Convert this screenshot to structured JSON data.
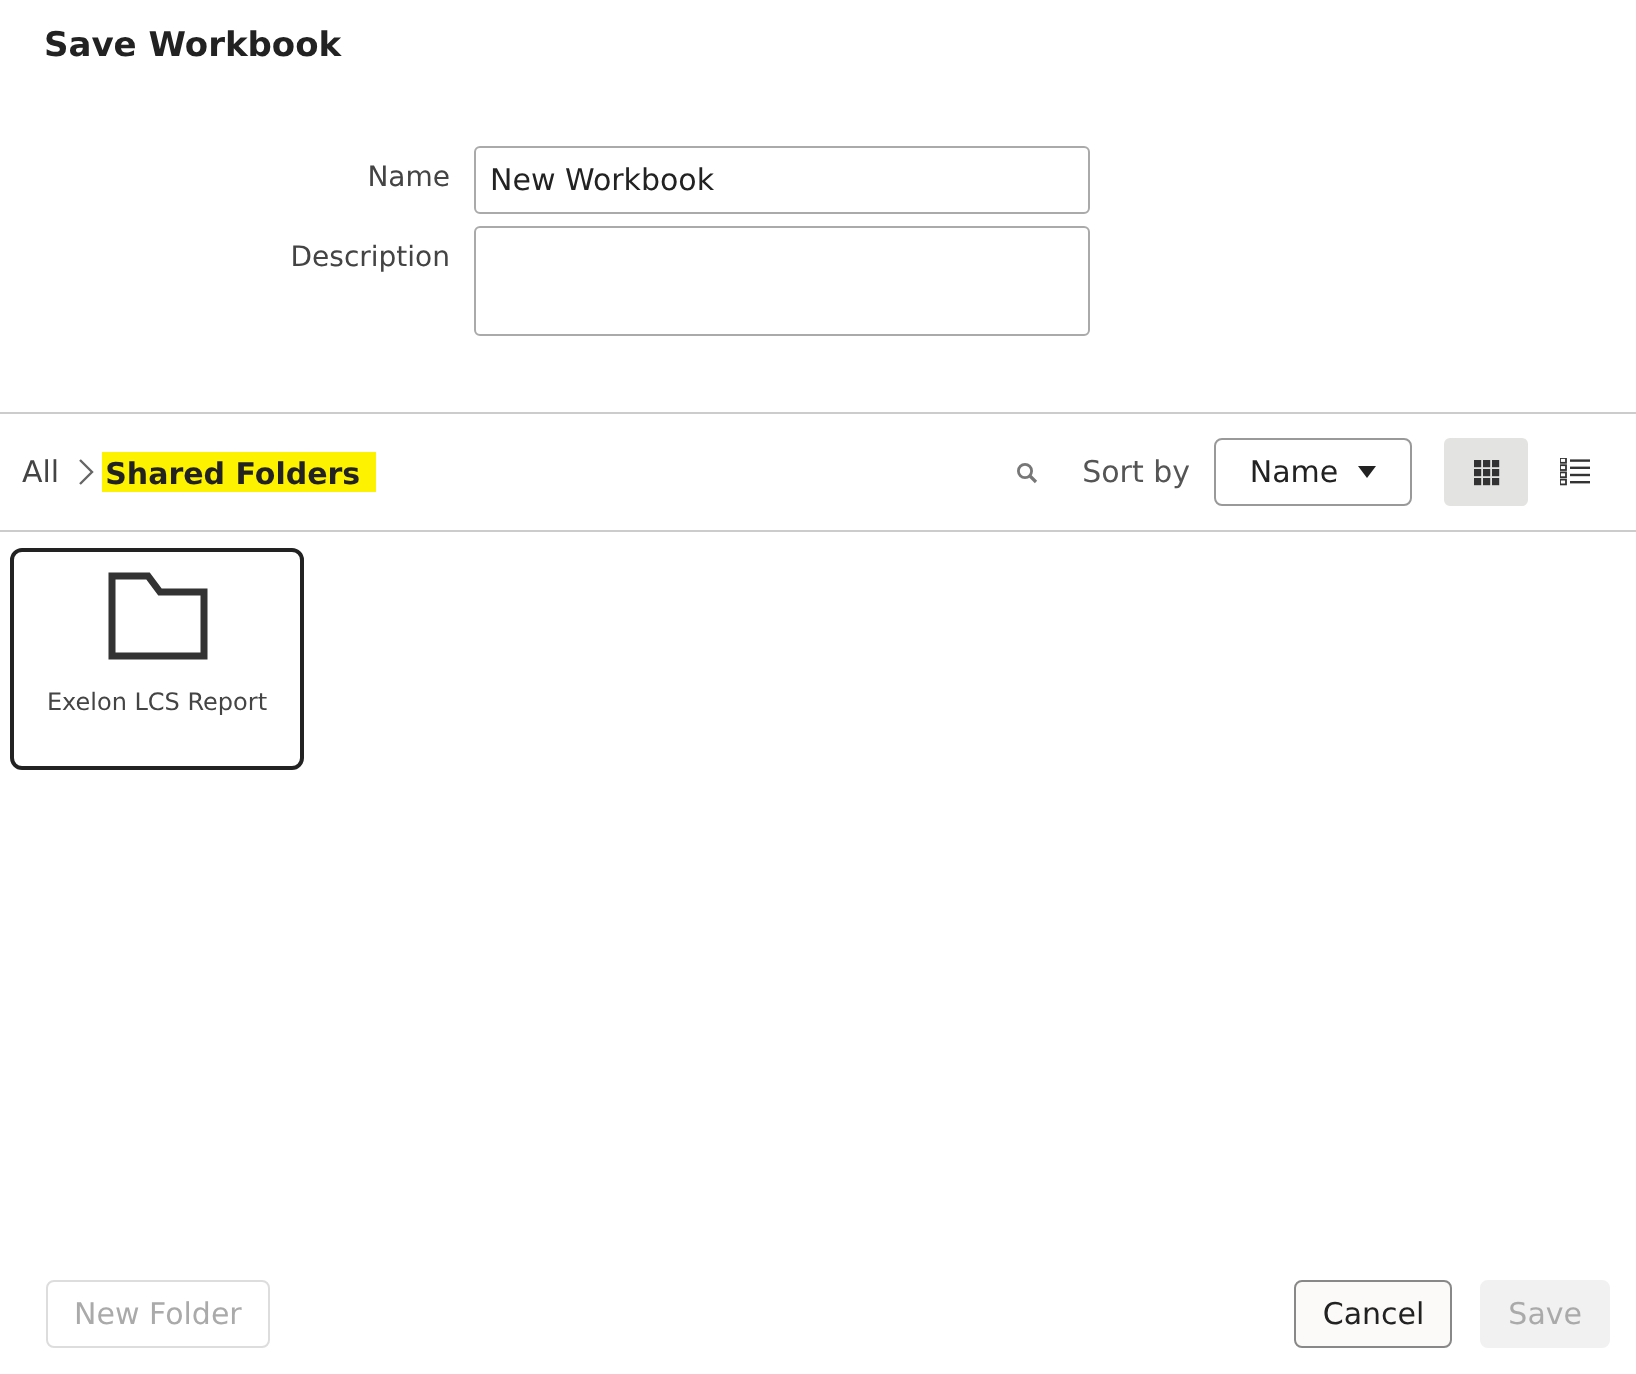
{
  "dialog": {
    "title": "Save Workbook"
  },
  "form": {
    "name": {
      "label": "Name",
      "value": "New Workbook"
    },
    "description": {
      "label": "Description"
    }
  },
  "breadcrumb": [
    {
      "label": "All",
      "highlighted": false
    },
    {
      "label": "Shared Folders",
      "highlighted": true
    }
  ],
  "toolbar": {
    "sort_label": "Sort by",
    "sort_value": "Name",
    "views": [
      {
        "kind": "grid",
        "selected": true
      },
      {
        "kind": "list",
        "selected": false
      }
    ]
  },
  "items": [
    {
      "label": "Exelon LCS Report",
      "selected": true
    }
  ],
  "buttons": [
    {
      "label": "New Folder",
      "disabled": true,
      "kind": "secondary"
    },
    {
      "label": "Cancel",
      "disabled": false,
      "kind": "secondary"
    },
    {
      "label": "Save",
      "disabled": true,
      "kind": "primary"
    }
  ]
}
